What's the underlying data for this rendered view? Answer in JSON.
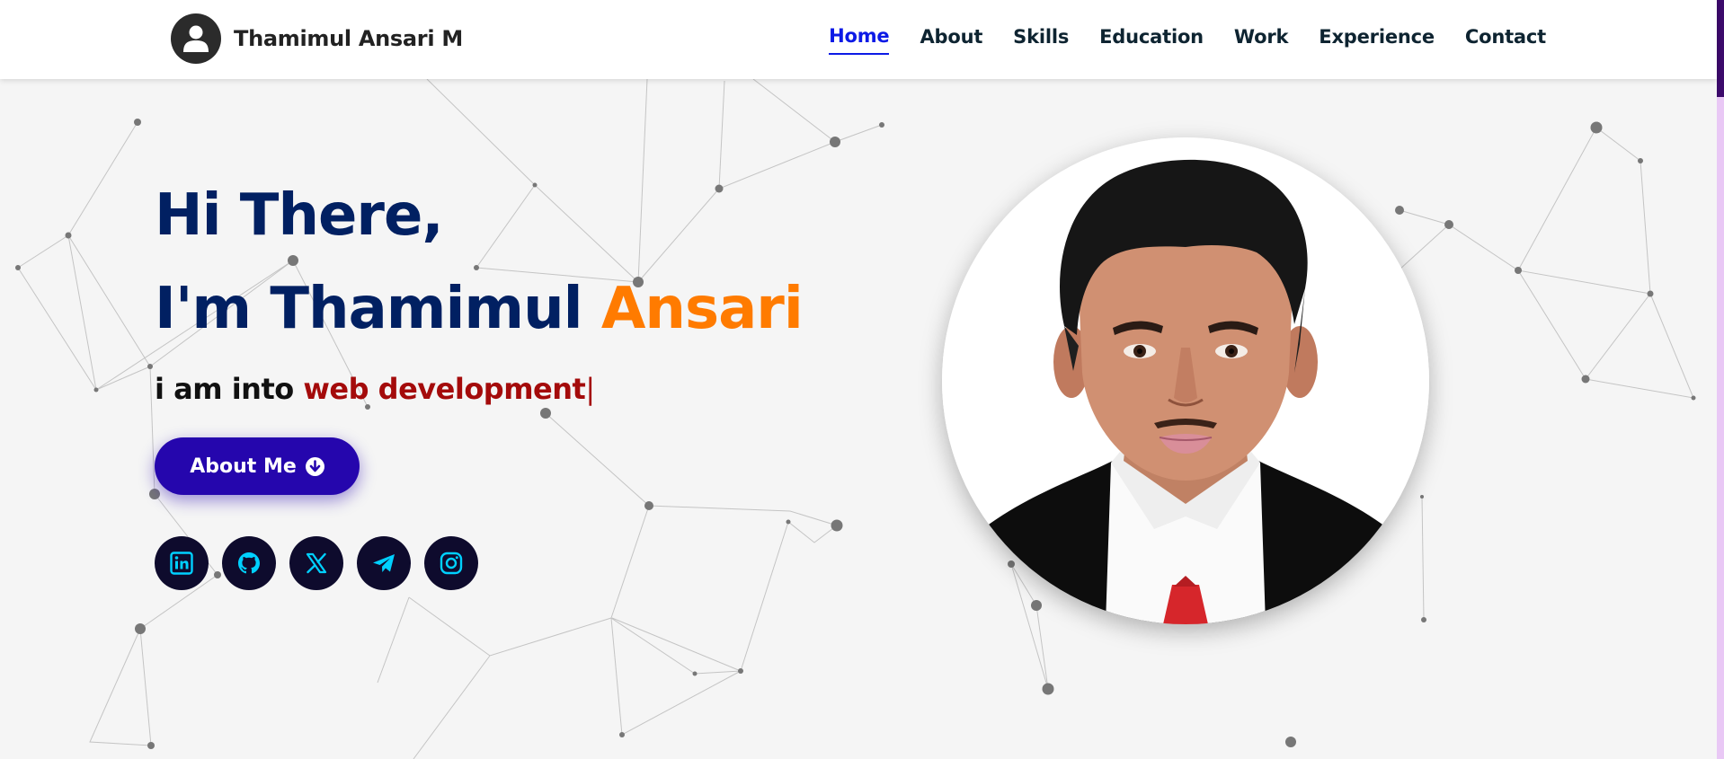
{
  "header": {
    "brand_name": "Thamimul Ansari M",
    "nav": [
      {
        "label": "Home",
        "active": true
      },
      {
        "label": "About"
      },
      {
        "label": "Skills"
      },
      {
        "label": "Education"
      },
      {
        "label": "Work"
      },
      {
        "label": "Experience"
      },
      {
        "label": "Contact"
      }
    ]
  },
  "hero": {
    "greeting": "Hi There,",
    "intro_prefix": "I'm Thamimul",
    "intro_highlight": "Ansari",
    "typing_prefix": "i am into",
    "typing_text": "web development",
    "typing_cursor": "|",
    "about_button_label": "About Me",
    "socials": [
      {
        "icon": "linkedin-icon"
      },
      {
        "icon": "github-icon"
      },
      {
        "icon": "x-twitter-icon"
      },
      {
        "icon": "telegram-icon"
      },
      {
        "icon": "instagram-icon"
      }
    ]
  },
  "colors": {
    "heading": "#012062",
    "accent_orange": "#ff7b00",
    "typing_red": "#a40b0b",
    "nav_active": "#0c1ae6",
    "button": "#2506ad",
    "social_bg": "#0e0b2d",
    "social_icon": "#00d0ff"
  }
}
